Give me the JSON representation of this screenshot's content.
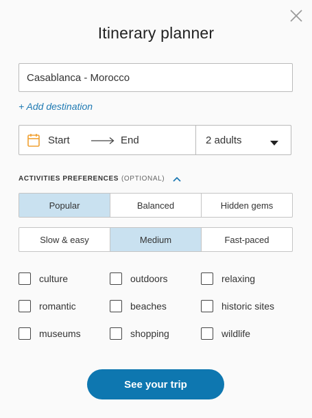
{
  "header": {
    "title": "Itinerary planner",
    "close_icon": "close-icon"
  },
  "destination": {
    "value": "Casablanca - Morocco",
    "add_label": "+ Add destination"
  },
  "dates": {
    "calendar_icon": "calendar-icon",
    "start_label": "Start",
    "arrow_icon": "arrow-right-icon",
    "end_label": "End"
  },
  "travelers": {
    "selected": "2 adults",
    "caret_icon": "caret-down-icon"
  },
  "activities": {
    "heading": "ACTIVITIES PREFERENCES",
    "optional": "(OPTIONAL)",
    "chevron_icon": "chevron-up-icon",
    "popularity": [
      {
        "label": "Popular",
        "active": true
      },
      {
        "label": "Balanced",
        "active": false
      },
      {
        "label": "Hidden gems",
        "active": false
      }
    ],
    "pace": [
      {
        "label": "Slow & easy",
        "active": false
      },
      {
        "label": "Medium",
        "active": true
      },
      {
        "label": "Fast-paced",
        "active": false
      }
    ],
    "checkboxes": [
      {
        "label": "culture",
        "checked": false
      },
      {
        "label": "outdoors",
        "checked": false
      },
      {
        "label": "relaxing",
        "checked": false
      },
      {
        "label": "romantic",
        "checked": false
      },
      {
        "label": "beaches",
        "checked": false
      },
      {
        "label": "historic sites",
        "checked": false
      },
      {
        "label": "museums",
        "checked": false
      },
      {
        "label": "shopping",
        "checked": false
      },
      {
        "label": "wildlife",
        "checked": false
      }
    ]
  },
  "cta": {
    "label": "See your trip"
  },
  "colors": {
    "accent": "#0e77b0",
    "link": "#1f7ab3",
    "segment_active": "#c9e1f0",
    "calendar_orange": "#f0a030"
  }
}
